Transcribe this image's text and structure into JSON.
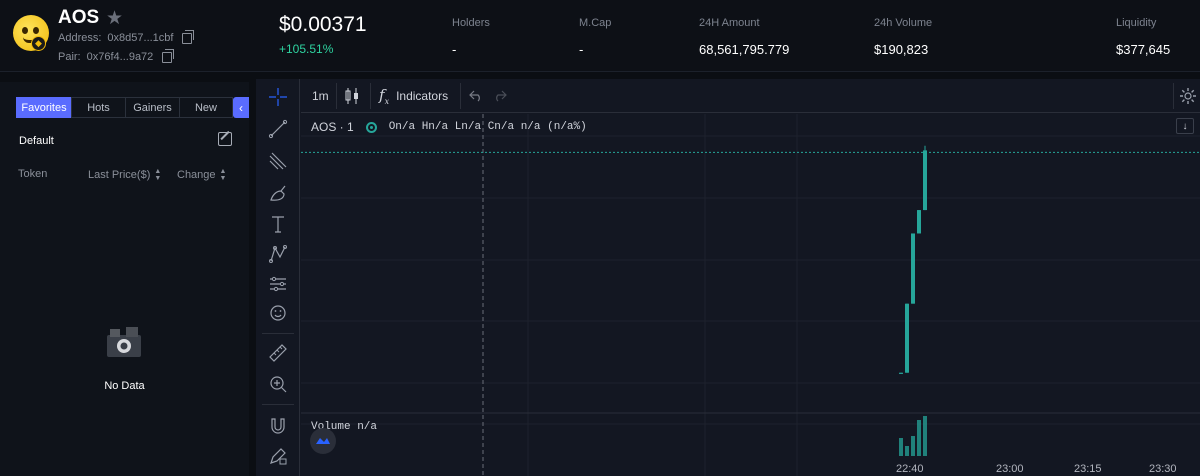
{
  "header": {
    "token_name": "AOS",
    "address_label": "Address:",
    "address_value": "0x8d57...1cbf",
    "pair_label": "Pair:",
    "pair_value": "0x76f4...9a72",
    "price": "$0.00371",
    "change": "+105.51%",
    "stats": [
      {
        "label": "Holders",
        "value": "-"
      },
      {
        "label": "M.Cap",
        "value": "-"
      },
      {
        "label": "24H Amount",
        "value": "68,561,795.779"
      },
      {
        "label": "24h Volume",
        "value": "$190,823"
      },
      {
        "label": "Liquidity",
        "value": "$377,645"
      }
    ]
  },
  "sidebar": {
    "tabs": [
      "Favorites",
      "Hots",
      "Gainers",
      "New"
    ],
    "active_tab": "Favorites",
    "group_label": "Default",
    "columns": [
      "Token",
      "Last Price($)",
      "Change"
    ],
    "empty_text": "No Data"
  },
  "chart": {
    "interval": "1m",
    "indicators_label": "Indicators",
    "symbol": "AOS · 1",
    "ohlc": "On/a Hn/a Ln/a Cn/a n/a (n/a%)",
    "volume_label": "Volume  n/a",
    "time_labels": [
      "22:40",
      "23:00",
      "23:15",
      "23:30"
    ],
    "up_color": "#26a69a"
  },
  "chart_data": {
    "type": "candlestick",
    "title": "",
    "x_ticks": [
      "22:40",
      "23:00",
      "23:15",
      "23:30"
    ],
    "candles": [
      {
        "open": 0.0018,
        "close": 0.00181,
        "high": 0.00181,
        "low": 0.0018
      },
      {
        "open": 0.00181,
        "close": 0.0024,
        "high": 0.0024,
        "low": 0.00181
      },
      {
        "open": 0.0024,
        "close": 0.003,
        "high": 0.003,
        "low": 0.0024
      },
      {
        "open": 0.003,
        "close": 0.0032,
        "high": 0.0032,
        "low": 0.003
      },
      {
        "open": 0.0032,
        "close": 0.00371,
        "high": 0.00375,
        "low": 0.0032
      }
    ],
    "volume_relative": [
      0.45,
      0.25,
      0.5,
      0.9,
      1.0
    ],
    "current_price": 0.00371
  }
}
